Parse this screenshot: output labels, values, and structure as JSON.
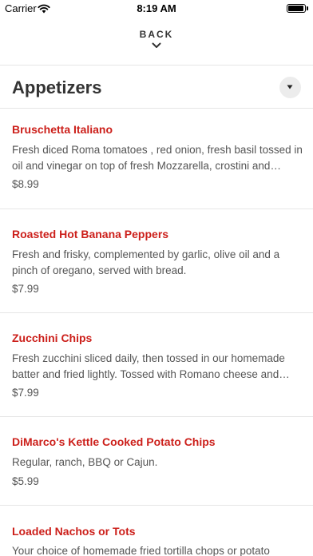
{
  "status_bar": {
    "carrier": "Carrier",
    "time": "8:19 AM",
    "battery_level": 0.95
  },
  "nav": {
    "back_label": "BACK"
  },
  "section": {
    "title": "Appetizers"
  },
  "items": [
    {
      "name": "Bruschetta Italiano",
      "description": "Fresh diced Roma tomatoes , red onion, fresh basil tossed in oil and vinegar on top of fresh Mozzarella, crostini and balsamic glaze.",
      "price": "$8.99"
    },
    {
      "name": "Roasted Hot Banana Peppers",
      "description": "Fresh and frisky, complemented by garlic, olive oil and a pinch of oregano, served with bread.",
      "price": "$7.99"
    },
    {
      "name": "Zucchini Chips",
      "description": "Fresh zucchini sliced daily, then tossed in our homemade batter and fried lightly. Tossed with Romano cheese and served with marinara.",
      "price": "$7.99"
    },
    {
      "name": "DiMarco's Kettle Cooked Potato Chips",
      "description": "Regular, ranch, BBQ or Cajun.",
      "price": "$5.99"
    },
    {
      "name": "Loaded Nachos or Tots",
      "description": "Your choice of homemade fried tortilla chops or potato",
      "price": ""
    }
  ]
}
